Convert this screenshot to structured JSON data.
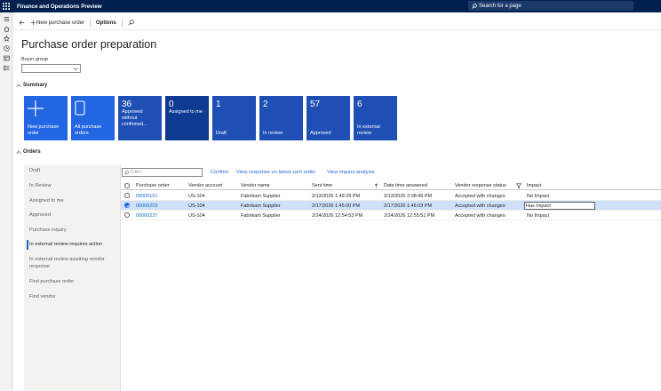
{
  "app": {
    "title": "Finance and Operations Preview",
    "search_placeholder": "Search for a page"
  },
  "actionbar": {
    "new_po": "New purchase order",
    "options": "Options"
  },
  "page": {
    "title": "Purchase order preparation",
    "buyer_group_label": "Buyer group",
    "buyer_group_value": ""
  },
  "summary": {
    "heading": "Summary",
    "tiles": [
      {
        "label": "New purchase order",
        "icon": "plus-icon"
      },
      {
        "label": "All purchase orders",
        "icon": "document-icon"
      },
      {
        "count": "36",
        "label": "Approved without confirmed..."
      },
      {
        "count": "0",
        "label": "Assigned to me"
      },
      {
        "count": "1",
        "label": "Draft"
      },
      {
        "count": "2",
        "label": "In review"
      },
      {
        "count": "57",
        "label": "Approved"
      },
      {
        "count": "6",
        "label": "In external review"
      }
    ]
  },
  "orders": {
    "heading": "Orders",
    "nav": [
      "Draft",
      "In Review",
      "Assigned to me",
      "Approved",
      "Purchase inquiry",
      "In external review requires action",
      "In external review awaiting vendor response",
      "Find purchase order",
      "Find vendor"
    ],
    "active_nav": 5,
    "filter_placeholder": "Filter",
    "actions": [
      "Confirm",
      "View response on latest sent order",
      "View impact analysis"
    ],
    "columns": [
      "Purchase order",
      "Vendor account",
      "Vendor name",
      "Sent time",
      "Date time answered",
      "Vendor response status",
      "Impact"
    ],
    "rows": [
      {
        "po": "00000151",
        "account": "US-104",
        "vendor": "Fabrikam Supplier",
        "sent": "2/13/2026 1:49:29 PM",
        "answered": "2/13/2026 2:08:49 PM",
        "status": "Accepted with changes",
        "impact": "No Impact",
        "selected": false
      },
      {
        "po": "00000203",
        "account": "US-104",
        "vendor": "Fabrikam Supplier",
        "sent": "2/17/2026 1:45:00 PM",
        "answered": "2/17/2026 1:46:03 PM",
        "status": "Accepted with changes",
        "impact": "Has Impact",
        "selected": true
      },
      {
        "po": "00000227",
        "account": "US-104",
        "vendor": "Fabrikam Supplier",
        "sent": "2/24/2026 12:54:53 PM",
        "answered": "2/24/2026 12:55:51 PM",
        "status": "Accepted with changes",
        "impact": "No Impact",
        "selected": false
      }
    ]
  },
  "colors": {
    "topbar": "#002050",
    "tile_blue": "#2266e3",
    "tile_dark": "#0f3a92",
    "link": "#0f6cbd",
    "selected_row": "#cfe0fb"
  }
}
